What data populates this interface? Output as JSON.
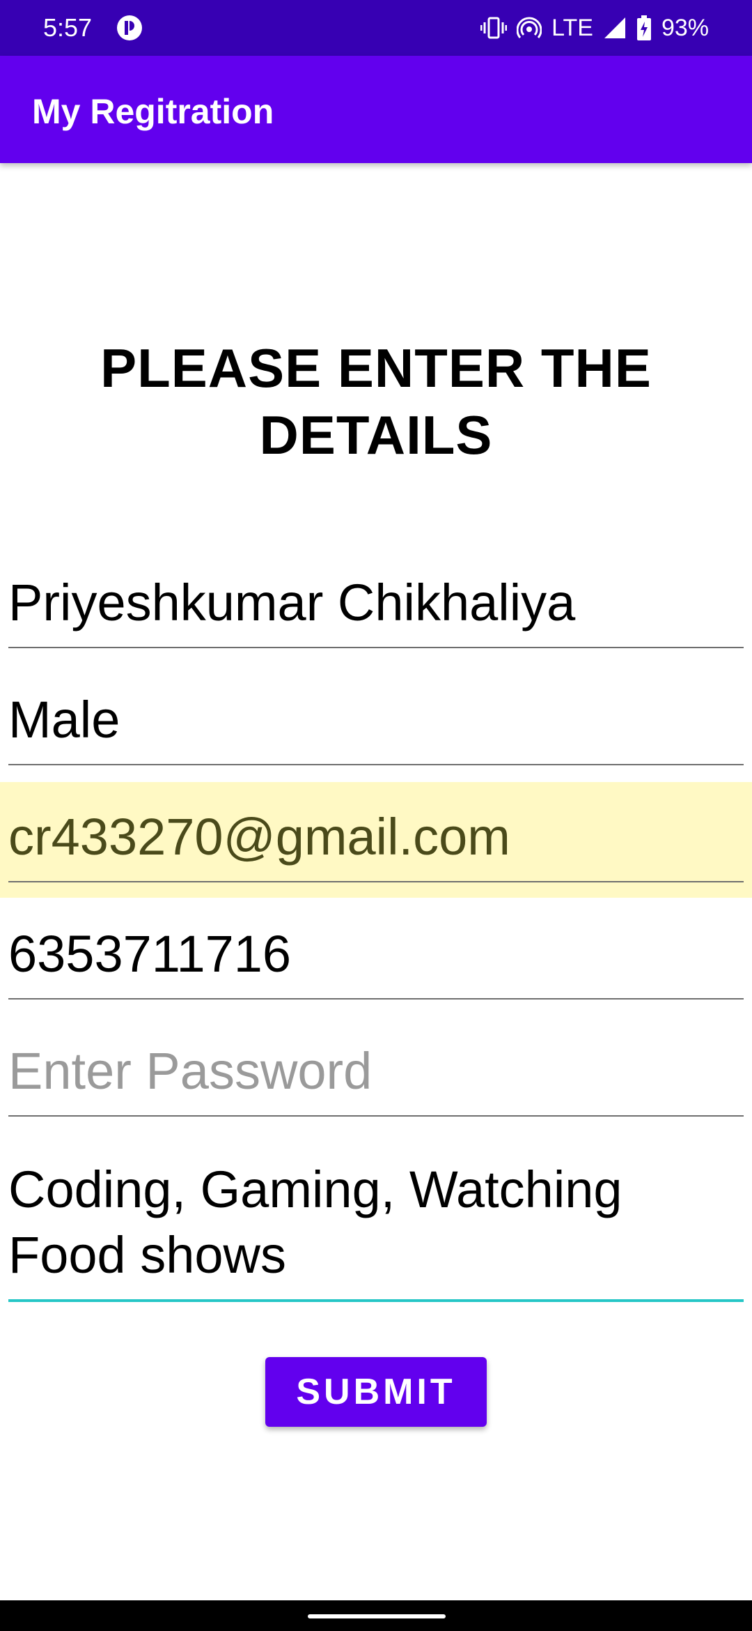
{
  "status_bar": {
    "time": "5:57",
    "network": "LTE",
    "battery": "93%",
    "icons": [
      "app-notification-icon",
      "vibrate-icon",
      "hotspot-icon",
      "signal-icon",
      "battery-charging-icon"
    ]
  },
  "app_bar": {
    "title": "My Regitration",
    "color": "#6200ee",
    "status_color": "#3700b3"
  },
  "form": {
    "heading": "PLEASE ENTER THE DETAILS",
    "name_value": "Priyeshkumar Chikhaliya",
    "gender_value": "Male",
    "email_value": "cr433270@gmail.com",
    "phone_value": "6353711716",
    "password_placeholder": "Enter Password",
    "password_value": "",
    "hobbies_value": "Coding, Gaming, Watching Food shows",
    "submit_label": "SUBMIT",
    "focus_color": "#26c6c6",
    "highlight_color": "#fff9c4"
  }
}
